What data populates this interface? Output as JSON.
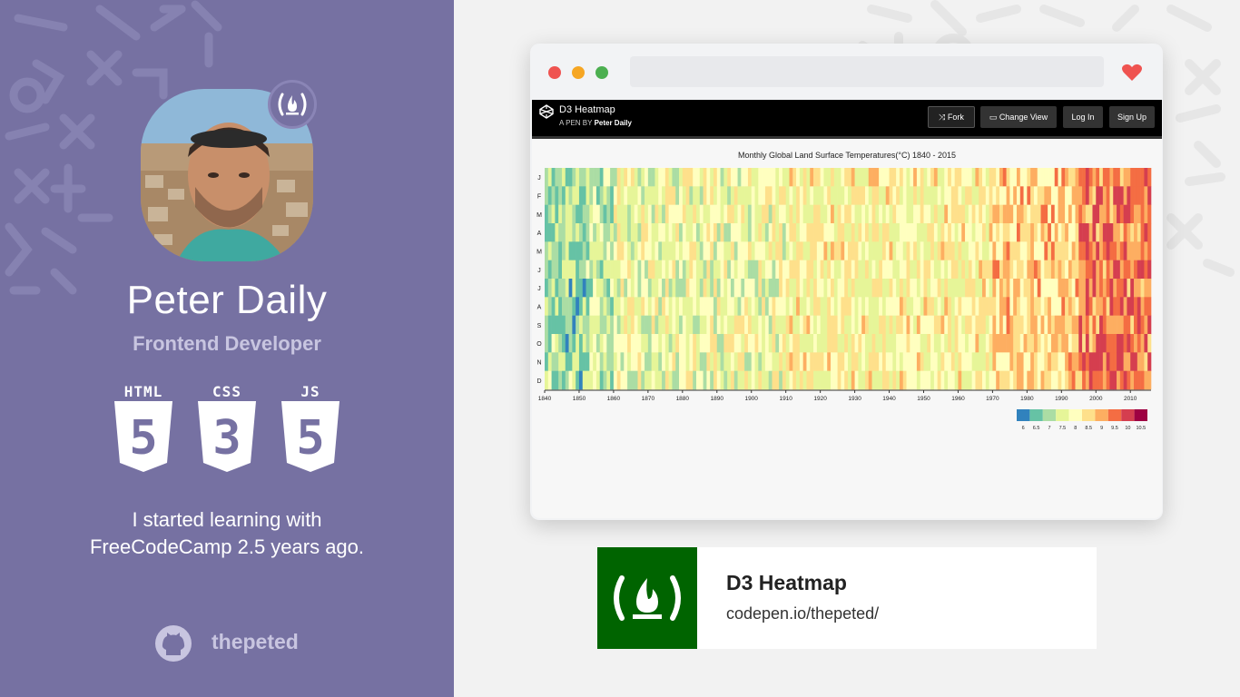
{
  "profile": {
    "name": "Peter Daily",
    "role": "Frontend Developer",
    "bio_line1": "I started learning with",
    "bio_line2": "FreeCodeCamp 2.5 years ago.",
    "github_handle": "thepeted"
  },
  "technologies": [
    {
      "label": "HTML",
      "digit": "5",
      "icon": "html5-shield-icon"
    },
    {
      "label": "CSS",
      "digit": "3",
      "icon": "css3-shield-icon"
    },
    {
      "label": "JS",
      "digit": "5",
      "icon": "js-shield-icon"
    }
  ],
  "browser": {
    "pen": {
      "title": "D3 Heatmap",
      "author_prefix": "A PEN BY",
      "author": "Peter Daily"
    },
    "buttons": {
      "fork": "Fork",
      "change_view": "Change View",
      "log_in": "Log In",
      "sign_up": "Sign Up"
    }
  },
  "chart_data": {
    "type": "heatmap",
    "title": "Monthly Global Land Surface Temperatures(°C) 1840 - 2015",
    "y_categories": [
      "J",
      "F",
      "M",
      "A",
      "M",
      "J",
      "J",
      "A",
      "S",
      "O",
      "N",
      "D"
    ],
    "x_range": [
      1840,
      2015
    ],
    "x_ticks": [
      1840,
      1850,
      1860,
      1870,
      1880,
      1890,
      1900,
      1910,
      1920,
      1930,
      1940,
      1950,
      1960,
      1970,
      1980,
      1990,
      2000,
      2010
    ],
    "legend": {
      "values": [
        "6",
        "6.5",
        "7",
        "7.5",
        "8",
        "8.5",
        "9",
        "9.5",
        "10",
        "10.5"
      ],
      "colors": [
        "#3182bd",
        "#66c2a5",
        "#abdda4",
        "#e6f598",
        "#ffffbf",
        "#fee08b",
        "#fdae61",
        "#f46d43",
        "#d53e4f",
        "#9e0142"
      ],
      "placement": "bottom-right"
    },
    "grid": false
  },
  "card": {
    "title": "D3 Heatmap",
    "url": "codepen.io/thepeted/",
    "accent": "#006400"
  },
  "colors": {
    "left_panel": "#7671a2",
    "browser_close": "#ef5350",
    "browser_min": "#f6a623",
    "browser_max": "#4caf50",
    "heart": "#ef5350"
  }
}
